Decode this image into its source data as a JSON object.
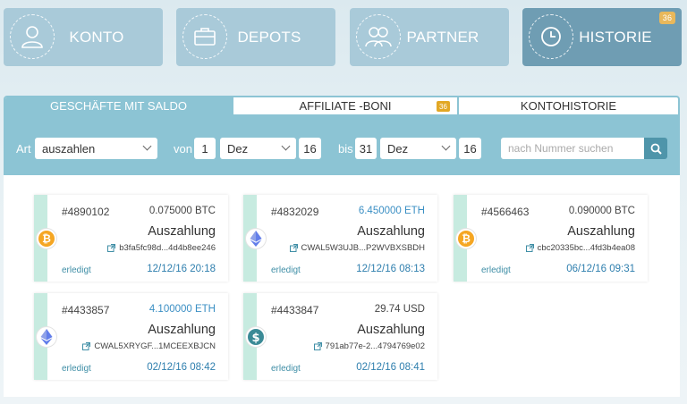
{
  "nav": [
    {
      "label": "KONTO",
      "icon": "user-icon",
      "active": false
    },
    {
      "label": "DEPOTS",
      "icon": "briefcase-icon",
      "active": false
    },
    {
      "label": "PARTNER",
      "icon": "partner-icon",
      "active": false
    },
    {
      "label": "HISTORIE",
      "icon": "history-icon",
      "active": true,
      "badge": "36"
    }
  ],
  "tabs": [
    {
      "label": "GESCHÄFTE MIT SALDO",
      "active": true
    },
    {
      "label": "AFFILIATE -BONI",
      "active": false,
      "badge": "36"
    },
    {
      "label": "KONTOHISTORIE",
      "active": false
    }
  ],
  "filter": {
    "art_label": "Art",
    "art_value": "auszahlen",
    "von_label": "von",
    "von_day": "1",
    "von_month": "Dez",
    "von_year": "16",
    "bis_label": "bis",
    "bis_day": "31",
    "bis_month": "Dez",
    "bis_year": "16",
    "search_placeholder": "nach Nummer suchen"
  },
  "colors": {
    "accent": "#8cc4d4",
    "nav_button": "#a9cad9",
    "nav_active": "#6f9db3",
    "badge": "#e9b85b",
    "status_strip": "#c7ebe0",
    "bitcoin": "#f5a623",
    "ethereum": "#627eea",
    "dollar": "#3b8a96"
  },
  "transactions": [
    {
      "id": "#4890102",
      "amount": "0.075000 BTC",
      "amount_highlight": false,
      "type": "Auszahlung",
      "address": "b3fa5fc98d...4d4b8ee246",
      "status": "erledigt",
      "date": "12/12/16 20:18",
      "coin": "bitcoin-icon"
    },
    {
      "id": "#4832029",
      "amount": "6.450000 ETH",
      "amount_highlight": true,
      "type": "Auszahlung",
      "address": "CWAL5W3UJB...P2WVBXSBDH",
      "status": "erledigt",
      "date": "12/12/16 08:13",
      "coin": "ethereum-icon"
    },
    {
      "id": "#4566463",
      "amount": "0.090000 BTC",
      "amount_highlight": false,
      "type": "Auszahlung",
      "address": "cbc20335bc...4fd3b4ea08",
      "status": "erledigt",
      "date": "06/12/16 09:31",
      "coin": "bitcoin-icon"
    },
    {
      "id": "#4433857",
      "amount": "4.100000 ETH",
      "amount_highlight": true,
      "type": "Auszahlung",
      "address": "CWAL5XRYGF...1MCEEXBJCN",
      "status": "erledigt",
      "date": "02/12/16 08:42",
      "coin": "ethereum-icon"
    },
    {
      "id": "#4433847",
      "amount": "29.74 USD",
      "amount_highlight": false,
      "type": "Auszahlung",
      "address": "791ab77e-2...4794769e02",
      "status": "erledigt",
      "date": "02/12/16 08:41",
      "coin": "dollar-icon"
    }
  ]
}
